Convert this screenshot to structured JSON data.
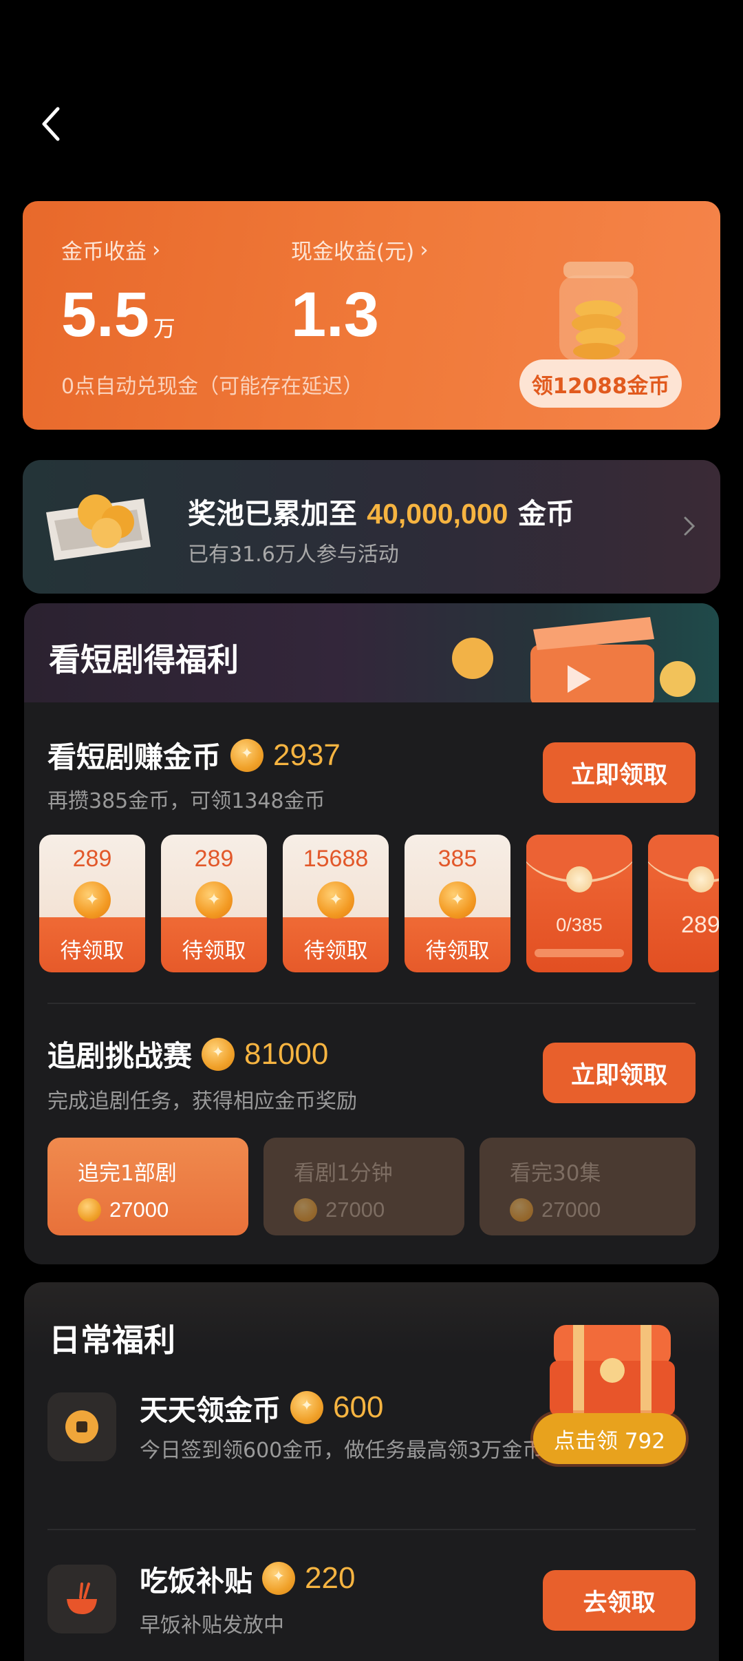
{
  "earnings": {
    "coin_label": "金币收益",
    "coin_value": "5.5",
    "coin_unit": "万",
    "cash_label": "现金收益(元)",
    "cash_value": "1.3",
    "note": "0点自动兑现金（可能存在延迟）",
    "claim_label": "领12088金币"
  },
  "pool": {
    "title_prefix": "奖池已累加至",
    "amount": "40,000,000",
    "title_suffix": "金币",
    "subtitle": "已有31.6万人参与活动"
  },
  "drama": {
    "header": "看短剧得福利",
    "earn": {
      "title": "看短剧赚金币",
      "coins": "2937",
      "subtitle": "再攒385金币，可领1348金币",
      "button": "立即领取"
    },
    "envelopes": [
      {
        "amount": "289",
        "status": "待领取"
      },
      {
        "amount": "289",
        "status": "待领取"
      },
      {
        "amount": "15688",
        "status": "待领取"
      },
      {
        "amount": "385",
        "status": "待领取"
      }
    ],
    "locked_envelope": {
      "progress": "0/385",
      "progress_fraction": 0
    },
    "partial_envelope": {
      "amount": "289"
    },
    "challenge": {
      "title": "追剧挑战赛",
      "coins": "81000",
      "subtitle": "完成追剧任务，获得相应金币奖励",
      "button": "立即领取"
    },
    "tasks": [
      {
        "label": "追完1部剧",
        "coins": "27000"
      },
      {
        "label": "看剧1分钟",
        "coins": "27000"
      },
      {
        "label": "看完30集",
        "coins": "27000"
      }
    ]
  },
  "daily": {
    "header": "日常福利",
    "checkin": {
      "title": "天天领金币",
      "coins": "600",
      "subtitle": "今日签到领600金币，做任务最高领3万金币",
      "popup": "点击领 792"
    },
    "meal": {
      "title": "吃饭补贴",
      "coins": "220",
      "subtitle": "早饭补贴发放中",
      "button": "去领取"
    }
  }
}
